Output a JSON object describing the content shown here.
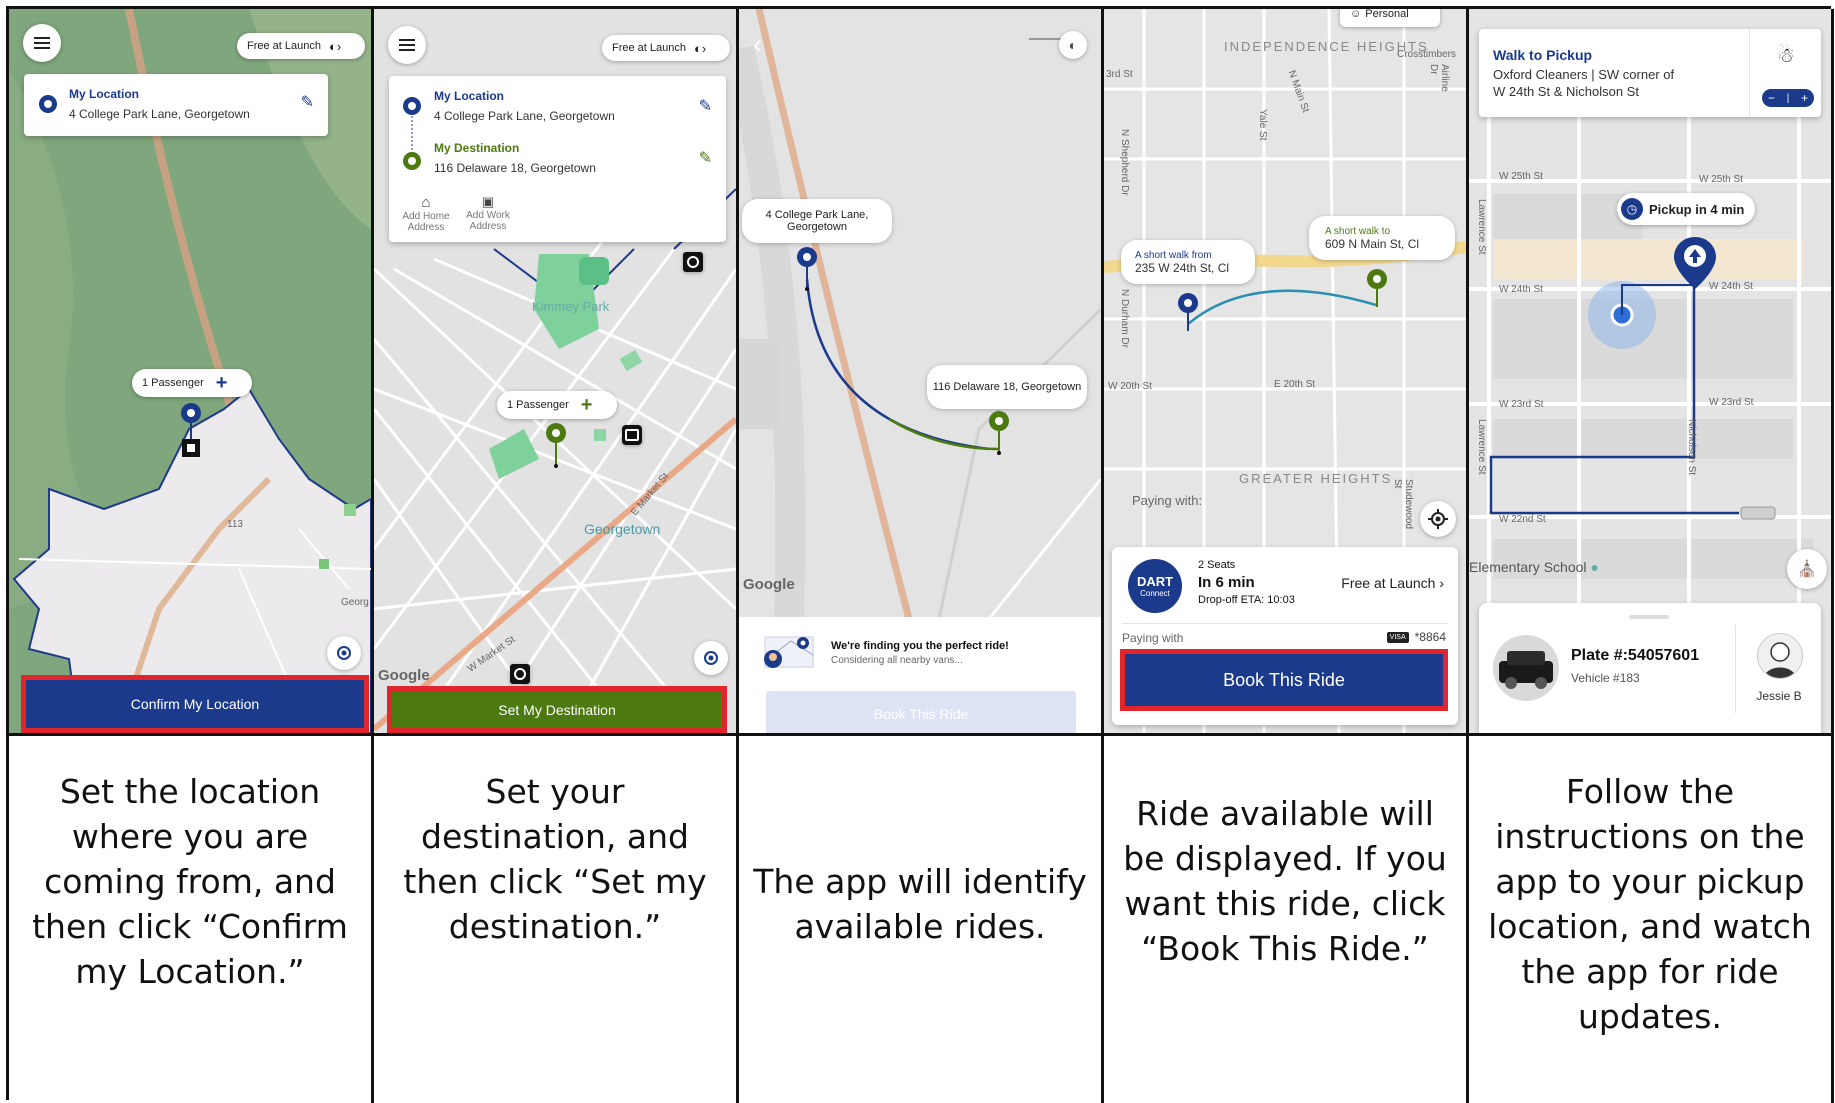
{
  "screens": [
    {
      "top_pill": "Free at Launch",
      "location_label": "My Location",
      "location_address": "4 College Park Lane, Georgetown",
      "passenger": "1 Passenger",
      "map_labels": [
        "113",
        "Georg"
      ],
      "button": "Confirm My Location",
      "caption": "Set the location where you are coming from, and then click “Confirm my Location.”"
    },
    {
      "top_pill": "Free at Launch",
      "location_label": "My Location",
      "location_address": "4 College Park Lane, Georgetown",
      "destination_label": "My Destination",
      "destination_address": "116 Delaware 18, Georgetown",
      "add_home": "Add Home Address",
      "add_work": "Add Work Address",
      "passenger": "1 Passenger",
      "map_labels": [
        "Kimmey Park",
        "Georgetown",
        "E Market St",
        "W Market St"
      ],
      "google": "Google",
      "button": "Set My Destination",
      "caption": "Set your destination, and then click “Set my destination.”"
    },
    {
      "origin_bubble": "4 College Park Lane, Georgetown",
      "dest_bubble": "116 Delaware 18, Georgetown",
      "google": "Google",
      "finding_title": "We're finding you the perfect ride!",
      "finding_sub": "Considering all nearby vans...",
      "button": "Book This Ride",
      "caption": "The app will identify available rides."
    },
    {
      "top_pill": "Personal",
      "area_top": "INDEPENDENCE HEIGHTS",
      "area_bottom": "GREATER HEIGHTS",
      "walk_from_label": "A short walk from",
      "walk_from_addr": "235 W 24th St, Cl",
      "walk_to_label": "A short walk to",
      "walk_to_addr": "609 N Main St, Cl",
      "street_labels": [
        "3rd St",
        "N Shepherd Dr",
        "N Main St",
        "Yale St",
        "Airline Dr",
        "Crosstimbers",
        "N Durham Dr",
        "W 20th St",
        "E 20th St",
        "Studewood St"
      ],
      "paying_with_map": "Paying with:",
      "seats": "2 Seats",
      "eta": "In 6 min",
      "dropoff": "Drop-off ETA: 10:03",
      "price": "Free at Launch",
      "logo_text": "DART",
      "logo_sub": "Connect",
      "paying_with": "Paying with",
      "card_brand": "VISA",
      "card_last4": "*8864",
      "button": "Book This Ride",
      "caption": "Ride available will be displayed. If you want this ride, click “Book This Ride.”"
    },
    {
      "walk_title": "Walk to Pickup",
      "walk_line1": "Oxford Cleaners | SW corner of",
      "walk_line2": "W 24th St & Nicholson St",
      "stepper_minus": "−",
      "stepper_plus": "+",
      "pickup_badge": "Pickup in 4 min",
      "street_labels": [
        "W 25th St",
        "W 25th St",
        "W 24th St",
        "W 24th St",
        "W 23rd St",
        "W 23rd St",
        "W 22nd St",
        "Lawrence St",
        "Lawrence St",
        "Nicholson St"
      ],
      "school": "Elementary School",
      "plate": "Plate #:54057601",
      "vehicle": "Vehicle #183",
      "driver": "Jessie B",
      "caption": "Follow the instructions on the app to your pickup location, and watch the app for ride updates."
    }
  ],
  "colors": {
    "dart_blue": "#1b3a8c",
    "dart_green": "#4d7a10",
    "highlight_red": "#e0262c",
    "route_teal": "#2a8fb0"
  }
}
